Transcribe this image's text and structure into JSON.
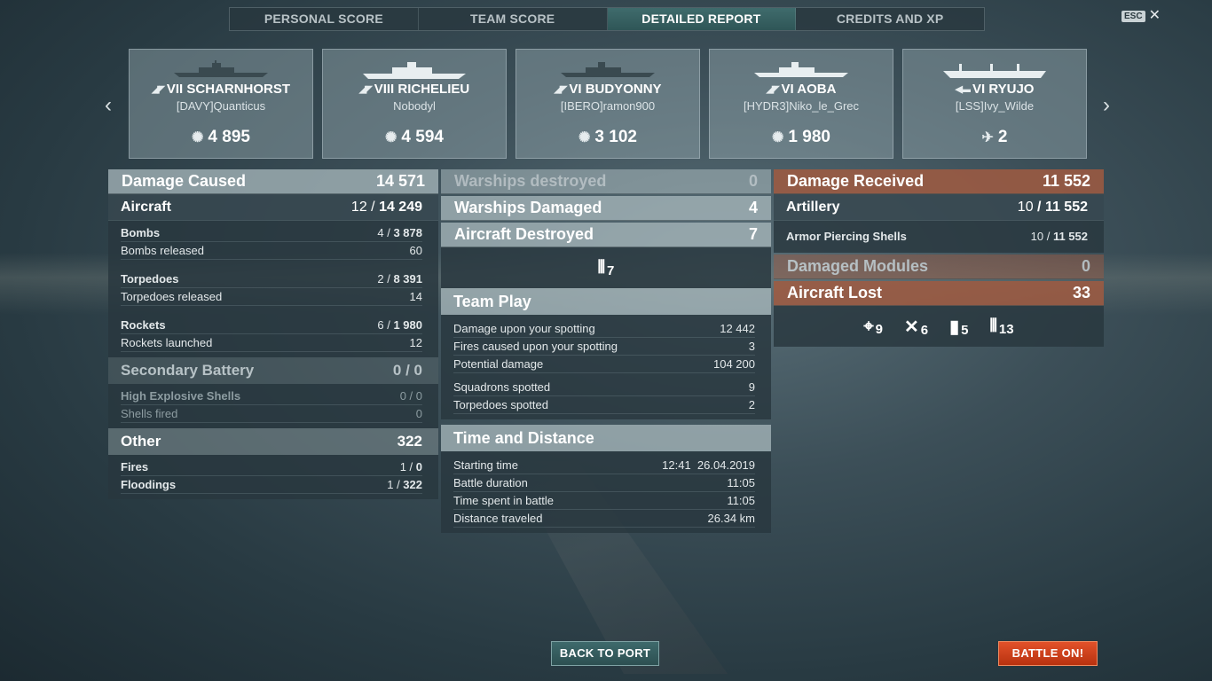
{
  "tabs": [
    "PERSONAL SCORE",
    "TEAM SCORE",
    "DETAILED REPORT",
    "CREDITS AND XP"
  ],
  "esc": {
    "key": "ESC",
    "close": "✕"
  },
  "nav": {
    "prev": "‹",
    "next": "›"
  },
  "ships": [
    {
      "name": "VII SCHARNHORST",
      "player": "[DAVY]Quanticus",
      "score": "4 895",
      "class_icon": "battleship-icon",
      "score_icon": "damage-icon"
    },
    {
      "name": "VIII RICHELIEU",
      "player": "Nobodyl",
      "score": "4 594",
      "class_icon": "battleship-icon",
      "score_icon": "damage-icon"
    },
    {
      "name": "VI BUDYONNY",
      "player": "[IBERO]ramon900",
      "score": "3 102",
      "class_icon": "cruiser-icon",
      "score_icon": "damage-icon"
    },
    {
      "name": "VI AOBA",
      "player": "[HYDR3]Niko_le_Grec",
      "score": "1 980",
      "class_icon": "cruiser-icon",
      "score_icon": "damage-icon"
    },
    {
      "name": "VI RYUJO",
      "player": "[LSS]Ivy_Wilde",
      "score": "2",
      "class_icon": "carrier-icon",
      "score_icon": "plane-destroyed-icon"
    }
  ],
  "left": {
    "damage_caused": {
      "label": "Damage Caused",
      "value": "14 571"
    },
    "aircraft": {
      "label": "Aircraft",
      "hits": "12",
      "sep": " / ",
      "dmg": "14 249"
    },
    "bombs": {
      "label": "Bombs",
      "hits": "4",
      "dmg": "3 878"
    },
    "bombs_released": {
      "label": "Bombs released",
      "value": "60"
    },
    "torpedoes": {
      "label": "Torpedoes",
      "hits": "2",
      "dmg": "8 391"
    },
    "torpedoes_released": {
      "label": "Torpedoes released",
      "value": "14"
    },
    "rockets": {
      "label": "Rockets",
      "hits": "6",
      "dmg": "1 980"
    },
    "rockets_launched": {
      "label": "Rockets launched",
      "value": "12"
    },
    "secondary": {
      "label": "Secondary Battery",
      "value": "0 / 0"
    },
    "he_shells": {
      "label": "High Explosive Shells",
      "value": "0 / 0"
    },
    "shells_fired": {
      "label": "Shells fired",
      "value": "0"
    },
    "other": {
      "label": "Other",
      "value": "322"
    },
    "fires": {
      "label": "Fires",
      "hits": "1",
      "dmg": "0"
    },
    "floodings": {
      "label": "Floodings",
      "hits": "1",
      "dmg": "322"
    }
  },
  "mid": {
    "warships_destroyed": {
      "label": "Warships destroyed",
      "value": "0"
    },
    "warships_damaged": {
      "label": "Warships Damaged",
      "value": "4"
    },
    "aircraft_destroyed": {
      "label": "Aircraft Destroyed",
      "value": "7"
    },
    "aircraft_destroyed_icon": {
      "icon": "aa-shells-icon",
      "value": "7"
    },
    "team_play": {
      "label": "Team Play"
    },
    "team_rows": [
      {
        "label": "Damage upon your spotting",
        "value": "12 442"
      },
      {
        "label": "Fires caused upon your spotting",
        "value": "3"
      },
      {
        "label": "Potential damage",
        "value": "104 200"
      },
      {
        "label": "Squadrons spotted",
        "value": "9"
      },
      {
        "label": "Torpedoes spotted",
        "value": "2"
      }
    ],
    "time_distance": {
      "label": "Time and Distance"
    },
    "time_rows": [
      {
        "label": "Starting time",
        "value": "12:41  26.04.2019"
      },
      {
        "label": "Battle duration",
        "value": "11:05"
      },
      {
        "label": "Time spent in battle",
        "value": "11:05"
      },
      {
        "label": "Distance traveled",
        "value": "26.34 km"
      }
    ]
  },
  "right": {
    "damage_received": {
      "label": "Damage Received",
      "value": "11 552"
    },
    "artillery": {
      "label": "Artillery",
      "hits": "10",
      "dmg": "11 552"
    },
    "ap_shells": {
      "label": "Armor Piercing Shells",
      "hits": "10",
      "dmg": "11 552"
    },
    "damaged_modules": {
      "label": "Damaged Modules",
      "value": "0"
    },
    "aircraft_lost": {
      "label": "Aircraft Lost",
      "value": "33"
    },
    "loss_icons": [
      {
        "icon": "crosshair-icon",
        "value": "9"
      },
      {
        "icon": "plane-shot-icon",
        "value": "6"
      },
      {
        "icon": "bomb-icon",
        "value": "5"
      },
      {
        "icon": "aa-shells-icon",
        "value": "13"
      }
    ]
  },
  "buttons": {
    "back": "BACK TO PORT",
    "battle": "BATTLE ON!"
  },
  "colors": {
    "accent_tab": "#3f6b6c",
    "received_header": "#a05a41",
    "battle_button": "#d8441d"
  }
}
